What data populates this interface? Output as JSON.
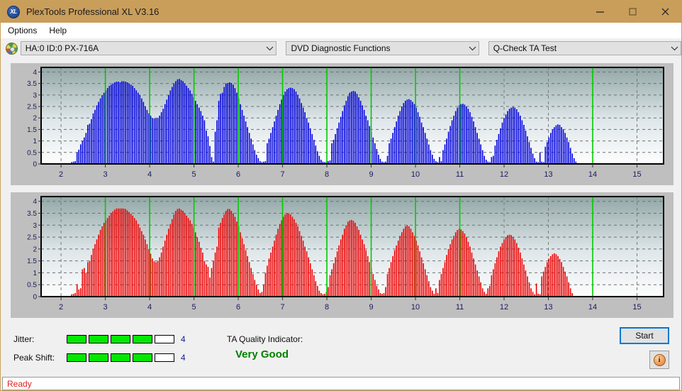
{
  "window": {
    "title": "PlexTools Professional XL V3.16",
    "app_icon": "XL",
    "minimize": "–",
    "maximize": "□",
    "close": "✕"
  },
  "menubar": {
    "items": [
      {
        "label": "Options"
      },
      {
        "label": "Help"
      }
    ]
  },
  "toolbar": {
    "device": {
      "value": "HA:0 ID:0  PX-716A",
      "icon": "disc-icon"
    },
    "function": {
      "value": "DVD Diagnostic Functions"
    },
    "test": {
      "value": "Q-Check TA Test"
    }
  },
  "meters": {
    "jitter": {
      "label": "Jitter:",
      "value": "4",
      "filled": 4,
      "total": 5
    },
    "peak_shift": {
      "label": "Peak Shift:",
      "value": "4",
      "filled": 4,
      "total": 5
    },
    "ta_quality": {
      "label": "TA Quality Indicator:",
      "value": "Very Good",
      "color": "#008000"
    }
  },
  "buttons": {
    "start": "Start",
    "info": "i"
  },
  "status": {
    "text": "Ready",
    "color": "#e02020"
  },
  "chart_data": [
    {
      "type": "bar",
      "name": "jitter-chart",
      "title": "",
      "xlabel": "",
      "ylabel": "",
      "color": "#0000dd",
      "ylim": [
        0,
        4.2
      ],
      "yticks": [
        0,
        0.5,
        1,
        1.5,
        2,
        2.5,
        3,
        3.5,
        4
      ],
      "ytick_labels": [
        "0",
        "0.5",
        "1",
        "1.5",
        "2",
        "2.5",
        "3",
        "3.5",
        "4"
      ],
      "xlim": [
        1.55,
        15.6
      ],
      "xticks": [
        2,
        3,
        4,
        5,
        6,
        7,
        8,
        9,
        10,
        11,
        12,
        13,
        14,
        15
      ],
      "xtick_labels": [
        "2",
        "3",
        "4",
        "5",
        "6",
        "7",
        "8",
        "9",
        "10",
        "11",
        "12",
        "13",
        "14",
        "15"
      ],
      "markers": [
        3,
        4,
        5,
        6,
        7,
        8,
        9,
        10,
        11,
        14
      ],
      "marker_color": "#00cc00",
      "grid": true,
      "x_start": 2.24,
      "x_step": 0.0405,
      "values": [
        0.08,
        0.1,
        0.12,
        0.5,
        0.62,
        0.85,
        1.0,
        1.15,
        1.35,
        1.7,
        1.75,
        1.95,
        2.2,
        2.35,
        2.55,
        2.7,
        2.85,
        3.0,
        3.1,
        3.2,
        3.3,
        3.4,
        3.45,
        3.5,
        3.55,
        3.58,
        3.58,
        3.55,
        3.6,
        3.6,
        3.58,
        3.55,
        3.5,
        3.45,
        3.4,
        3.3,
        3.2,
        3.1,
        3.0,
        2.85,
        2.7,
        2.5,
        2.35,
        2.2,
        2.1,
        2.0,
        1.98,
        1.98,
        2.0,
        2.1,
        2.25,
        2.4,
        2.6,
        2.8,
        3.0,
        3.2,
        3.35,
        3.5,
        3.6,
        3.68,
        3.7,
        3.65,
        3.6,
        3.5,
        3.4,
        3.3,
        3.2,
        3.05,
        2.9,
        2.75,
        2.6,
        2.45,
        2.3,
        2.1,
        1.9,
        1.45,
        1.2,
        0.78,
        0.3,
        0.1,
        1.4,
        1.9,
        2.75,
        3.05,
        3.1,
        3.35,
        3.5,
        3.52,
        3.55,
        3.52,
        3.45,
        3.3,
        3.1,
        2.85,
        2.6,
        2.35,
        2.1,
        1.85,
        1.6,
        1.35,
        1.1,
        0.85,
        0.6,
        0.4,
        0.25,
        0.12,
        0.08,
        0.1,
        0.12,
        0.9,
        1.1,
        1.35,
        1.6,
        1.85,
        2.1,
        2.35,
        2.6,
        2.8,
        3.0,
        3.15,
        3.25,
        3.3,
        3.32,
        3.3,
        3.25,
        3.15,
        3.0,
        2.85,
        2.65,
        2.45,
        2.25,
        2.0,
        1.8,
        1.55,
        1.3,
        1.05,
        0.8,
        0.55,
        0.35,
        0.18,
        0.1,
        0.08,
        0.1,
        0.12,
        0.15,
        0.9,
        1.05,
        1.3,
        1.55,
        1.8,
        2.05,
        2.3,
        2.55,
        2.75,
        2.95,
        3.1,
        3.15,
        3.18,
        3.15,
        3.05,
        2.9,
        2.75,
        2.55,
        2.35,
        2.1,
        1.9,
        1.65,
        1.4,
        1.15,
        0.9,
        0.65,
        0.4,
        0.22,
        0.1,
        0.08,
        0.1,
        0.35,
        0.9,
        1.1,
        1.35,
        1.6,
        1.85,
        2.1,
        2.3,
        2.5,
        2.65,
        2.75,
        2.8,
        2.82,
        2.78,
        2.7,
        2.6,
        2.45,
        2.25,
        2.05,
        1.8,
        1.6,
        1.35,
        1.1,
        0.85,
        0.6,
        0.4,
        0.22,
        0.12,
        0.08,
        0.3,
        0.12,
        0.6,
        0.85,
        1.1,
        1.4,
        1.65,
        1.9,
        2.1,
        2.3,
        2.45,
        2.55,
        2.6,
        2.62,
        2.58,
        2.5,
        2.4,
        2.25,
        2.05,
        1.85,
        1.6,
        1.35,
        1.1,
        0.85,
        0.6,
        0.35,
        0.18,
        0.1,
        0.08,
        0.3,
        0.35,
        0.8,
        1.05,
        1.3,
        1.55,
        1.8,
        2.0,
        2.15,
        2.3,
        2.4,
        2.45,
        2.48,
        2.45,
        2.38,
        2.25,
        2.1,
        1.9,
        1.7,
        1.45,
        1.2,
        0.95,
        0.7,
        0.45,
        0.25,
        0.1,
        0.08,
        0.5,
        0.1,
        0.08,
        0.75,
        0.95,
        1.15,
        1.35,
        1.5,
        1.6,
        1.68,
        1.72,
        1.7,
        1.6,
        1.5,
        1.35,
        1.15,
        0.95,
        0.7,
        0.45,
        0.25,
        0.1,
        0.0,
        0.0,
        0.0,
        0.0,
        0.0,
        0.0,
        0.0,
        0.0,
        0.0,
        0.0,
        0.0,
        0.0,
        0.0,
        0.0,
        0.0,
        0.0,
        0.0,
        0.0,
        0.0,
        0.0,
        0.0,
        0.0,
        0.0,
        0.0,
        0.0,
        0.0,
        0.0,
        0.0,
        0.0,
        0.0,
        0.0,
        0.0,
        0.0,
        0.0,
        0.0,
        0.0,
        0.0,
        0.0,
        0.0,
        0.0,
        0.0,
        0.0,
        0.0,
        0.0,
        0.0,
        0.0,
        0.0,
        0.0,
        0.0,
        0.0,
        0.0,
        0.0,
        0.0,
        0.0,
        0.0,
        0.0,
        0.0,
        0.0,
        0.0,
        0.1,
        0.1,
        0.35,
        0.55,
        0.85,
        1.1,
        1.35,
        1.55,
        1.7,
        1.78,
        1.72,
        1.6,
        1.45,
        1.25,
        1.05,
        0.85,
        0.85,
        0.1,
        0.1,
        0.0,
        0.0,
        0.0,
        0.0,
        0.0,
        0.0,
        0.0,
        0.0,
        0.0,
        0.0,
        0.0,
        0.0,
        0.0,
        0.0,
        0.0,
        0.0,
        0.0,
        0.0,
        0.0,
        0.0,
        0.0,
        0.0,
        0.0,
        0.0,
        0.0,
        0.0,
        0.0,
        0.0,
        0.0,
        0.0
      ]
    },
    {
      "type": "bar",
      "name": "peak-shift-chart",
      "title": "",
      "xlabel": "",
      "ylabel": "",
      "color": "#ee0000",
      "ylim": [
        0,
        4.2
      ],
      "yticks": [
        0,
        0.5,
        1,
        1.5,
        2,
        2.5,
        3,
        3.5,
        4
      ],
      "ytick_labels": [
        "0",
        "0.5",
        "1",
        "1.5",
        "2",
        "2.5",
        "3",
        "3.5",
        "4"
      ],
      "xlim": [
        1.55,
        15.6
      ],
      "xticks": [
        2,
        3,
        4,
        5,
        6,
        7,
        8,
        9,
        10,
        11,
        12,
        13,
        14,
        15
      ],
      "xtick_labels": [
        "2",
        "3",
        "4",
        "5",
        "6",
        "7",
        "8",
        "9",
        "10",
        "11",
        "12",
        "13",
        "14",
        "15"
      ],
      "markers": [
        3,
        4,
        5,
        6,
        7,
        8,
        9,
        10,
        11,
        14
      ],
      "marker_color": "#00cc00",
      "grid": true,
      "x_start": 2.24,
      "x_step": 0.0405,
      "values": [
        0.1,
        0.12,
        0.15,
        0.52,
        0.3,
        0.35,
        1.15,
        1.2,
        1.0,
        1.45,
        1.5,
        1.75,
        2.0,
        2.2,
        2.4,
        2.6,
        2.8,
        2.95,
        3.1,
        3.2,
        3.3,
        3.4,
        3.5,
        3.58,
        3.65,
        3.7,
        3.7,
        3.7,
        3.7,
        3.7,
        3.68,
        3.62,
        3.55,
        3.48,
        3.4,
        3.3,
        3.2,
        3.05,
        2.9,
        2.75,
        2.6,
        2.4,
        2.2,
        2.0,
        1.8,
        1.6,
        1.48,
        1.45,
        1.5,
        1.65,
        1.85,
        2.1,
        2.35,
        2.6,
        2.85,
        3.05,
        3.25,
        3.45,
        3.6,
        3.68,
        3.7,
        3.65,
        3.6,
        3.5,
        3.4,
        3.3,
        3.2,
        3.05,
        2.9,
        2.7,
        2.5,
        2.3,
        2.05,
        1.85,
        1.5,
        1.35,
        1.25,
        0.8,
        1.2,
        1.5,
        1.85,
        2.1,
        2.9,
        3.1,
        3.3,
        3.45,
        3.6,
        3.68,
        3.68,
        3.6,
        3.5,
        3.35,
        3.15,
        2.95,
        2.7,
        2.45,
        2.2,
        1.95,
        1.7,
        1.45,
        1.2,
        0.95,
        0.7,
        0.5,
        0.3,
        0.15,
        0.2,
        0.5,
        1.0,
        1.3,
        1.6,
        1.85,
        2.1,
        2.35,
        2.6,
        2.85,
        3.05,
        3.2,
        3.35,
        3.45,
        3.5,
        3.5,
        3.45,
        3.35,
        3.25,
        3.1,
        2.95,
        2.75,
        2.55,
        2.35,
        2.1,
        1.9,
        1.65,
        1.4,
        1.15,
        0.9,
        0.65,
        0.45,
        0.25,
        0.15,
        0.1,
        0.12,
        0.2,
        0.4,
        0.9,
        1.15,
        1.4,
        1.65,
        1.9,
        2.15,
        2.4,
        2.6,
        2.85,
        3.0,
        3.15,
        3.2,
        3.22,
        3.18,
        3.1,
        2.95,
        2.8,
        2.6,
        2.4,
        2.2,
        1.95,
        1.7,
        1.45,
        1.2,
        0.95,
        0.7,
        0.45,
        0.3,
        0.15,
        0.12,
        0.15,
        0.4,
        0.95,
        1.2,
        1.45,
        1.7,
        1.95,
        2.15,
        2.35,
        2.55,
        2.7,
        2.85,
        2.95,
        3.0,
        2.95,
        2.85,
        2.7,
        2.55,
        2.35,
        2.15,
        1.9,
        1.65,
        1.4,
        1.15,
        0.9,
        0.65,
        0.4,
        0.25,
        0.12,
        0.35,
        0.15,
        0.7,
        0.95,
        1.2,
        1.45,
        1.75,
        2.0,
        2.2,
        2.4,
        2.55,
        2.7,
        2.8,
        2.85,
        2.82,
        2.75,
        2.65,
        2.5,
        2.3,
        2.1,
        1.85,
        1.6,
        1.35,
        1.1,
        0.85,
        0.6,
        0.35,
        0.2,
        0.12,
        0.35,
        0.45,
        0.9,
        1.15,
        1.4,
        1.65,
        1.9,
        2.1,
        2.25,
        2.4,
        2.5,
        2.58,
        2.6,
        2.58,
        2.5,
        2.4,
        2.25,
        2.05,
        1.85,
        1.6,
        1.35,
        1.1,
        0.85,
        0.6,
        0.35,
        0.2,
        0.1,
        0.55,
        0.12,
        0.1,
        0.85,
        1.05,
        1.25,
        1.45,
        1.6,
        1.7,
        1.78,
        1.82,
        1.78,
        1.7,
        1.58,
        1.45,
        1.25,
        1.05,
        0.85,
        0.6,
        0.35,
        0.15,
        0.0,
        0.0,
        0.0,
        0.0,
        0.0,
        0.0,
        0.0,
        0.0,
        0.0,
        0.0,
        0.0,
        0.0,
        0.0,
        0.0,
        0.0,
        0.0,
        0.0,
        0.0,
        0.0,
        0.0,
        0.0,
        0.0,
        0.0,
        0.0,
        0.0,
        0.0,
        0.0,
        0.0,
        0.0,
        0.0,
        0.0,
        0.0,
        0.0,
        0.0,
        0.0,
        0.0,
        0.0,
        0.0,
        0.0,
        0.0,
        0.0,
        0.0,
        0.0,
        0.0,
        0.0,
        0.0,
        0.0,
        0.0,
        0.0,
        0.0,
        0.0,
        0.0,
        0.0,
        0.0,
        0.0,
        0.0,
        0.0,
        0.0,
        0.0,
        0.12,
        0.15,
        0.45,
        0.7,
        0.95,
        1.2,
        1.45,
        1.65,
        1.78,
        1.85,
        1.78,
        1.65,
        1.5,
        1.3,
        1.1,
        0.9,
        0.9,
        0.15,
        0.12,
        0.0,
        0.0,
        0.0,
        0.0,
        0.0,
        0.0,
        0.0,
        0.0,
        0.0,
        0.0,
        0.0,
        0.0,
        0.0,
        0.0,
        0.0,
        0.0,
        0.0,
        0.0,
        0.0,
        0.0,
        0.0,
        0.0,
        0.0,
        0.0,
        0.0,
        0.0,
        0.0,
        0.0,
        0.0,
        0.0
      ]
    }
  ]
}
